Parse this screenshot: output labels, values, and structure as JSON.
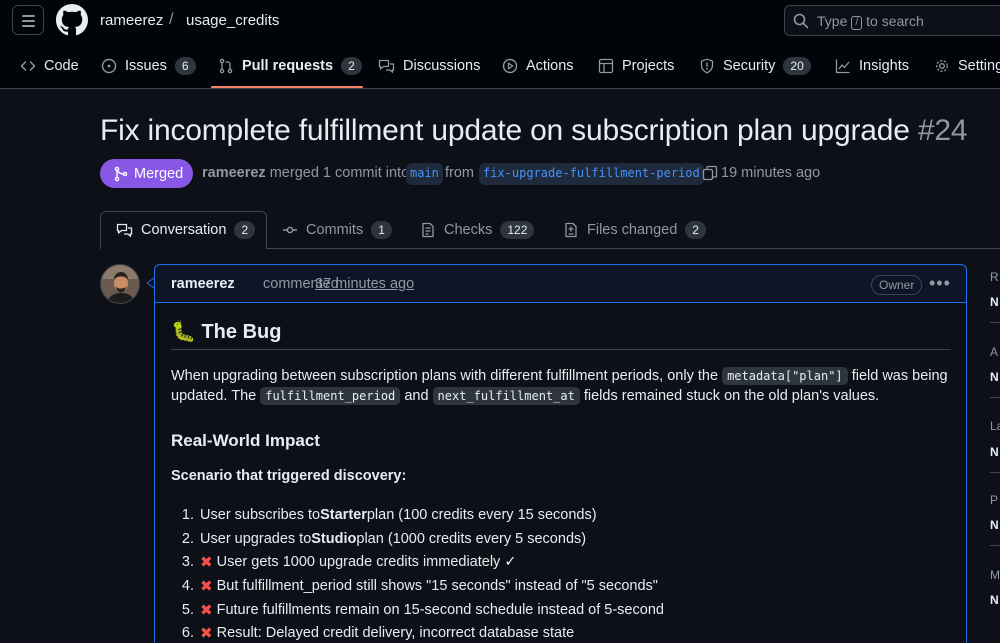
{
  "header": {
    "owner": "rameerez",
    "separator": "/",
    "repo": "usage_credits",
    "search_prefix": "Type",
    "search_key": "/",
    "search_suffix": "to search"
  },
  "repo_nav": {
    "items": [
      {
        "label": "Code",
        "icon": "code-icon"
      },
      {
        "label": "Issues",
        "count": "6",
        "icon": "issue-opened-icon"
      },
      {
        "label": "Pull requests",
        "count": "2",
        "icon": "git-pull-request-icon",
        "selected": true
      },
      {
        "label": "Discussions",
        "icon": "comment-discussion-icon"
      },
      {
        "label": "Actions",
        "icon": "play-icon"
      },
      {
        "label": "Projects",
        "icon": "table-icon"
      },
      {
        "label": "Security",
        "count": "20",
        "icon": "shield-icon"
      },
      {
        "label": "Insights",
        "icon": "graph-icon"
      },
      {
        "label": "Settings",
        "icon": "gear-icon"
      }
    ]
  },
  "pr": {
    "title": "Fix incomplete fulfillment update on subscription plan upgrade",
    "number": "#24",
    "state": "Merged",
    "author": "rameerez",
    "merge_text": "merged 1 commit into",
    "base_branch": "main",
    "from_text": "from",
    "head_branch": "fix-upgrade-fulfillment-period",
    "time_ago": "19 minutes ago"
  },
  "tabs": [
    {
      "label": "Conversation",
      "count": "2",
      "icon": "comment-discussion-icon",
      "active": true
    },
    {
      "label": "Commits",
      "count": "1",
      "icon": "git-commit-icon"
    },
    {
      "label": "Checks",
      "count": "122",
      "icon": "checklist-icon"
    },
    {
      "label": "Files changed",
      "count": "2",
      "icon": "file-diff-icon"
    }
  ],
  "comment": {
    "author": "rameerez",
    "action": "commented",
    "time": "37 minutes ago",
    "role": "Owner",
    "heading_emoji": "🐛",
    "heading": "The Bug",
    "para_1": "When upgrading between subscription plans with different fulfillment periods, only the",
    "code_1": "metadata[\"plan\"]",
    "para_2": "field was being updated. The",
    "code_2": "fulfillment_period",
    "para_3": "and",
    "code_3": "next_fulfillment_at",
    "para_4": "fields remained stuck on the old plan's values.",
    "subheading": "Real-World Impact",
    "scenario": "Scenario that triggered discovery:",
    "list": [
      {
        "n": "1.",
        "pre": "User subscribes to ",
        "bold": "Starter",
        "post": " plan (100 credits every 15 seconds)",
        "x": false
      },
      {
        "n": "2.",
        "pre": "User upgrades to ",
        "bold": "Studio",
        "post": " plan (1000 credits every 5 seconds)",
        "x": false
      },
      {
        "n": "3.",
        "pre": "User gets 1000 upgrade credits immediately ✓",
        "bold": "",
        "post": "",
        "x": true
      },
      {
        "n": "4.",
        "pre": "But fulfillment_period still shows \"15 seconds\" instead of \"5 seconds\"",
        "bold": "",
        "post": "",
        "x": true
      },
      {
        "n": "5.",
        "pre": "Future fulfillments remain on 15-second schedule instead of 5-second",
        "bold": "",
        "post": "",
        "x": true
      },
      {
        "n": "6.",
        "pre": "Result: Delayed credit delivery, incorrect database state",
        "bold": "",
        "post": "",
        "x": true
      }
    ]
  },
  "sidebar": {
    "items": [
      {
        "label": "R",
        "value": "N"
      },
      {
        "label": "A",
        "value": "N"
      },
      {
        "label": "La",
        "value": "N"
      },
      {
        "label": "P",
        "value": "N"
      },
      {
        "label": "M",
        "value": "N"
      }
    ]
  },
  "colors": {
    "merged": "#8957e5",
    "accent_underline": "#f78166",
    "link": "#4493f8",
    "error": "#f85149"
  }
}
